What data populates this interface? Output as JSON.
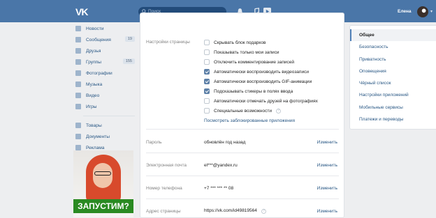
{
  "header": {
    "logo": "VK",
    "search_placeholder": "Поиск",
    "user_name": "Елена"
  },
  "nav": {
    "items": [
      {
        "label": "Новости",
        "icon": "news-icon"
      },
      {
        "label": "Сообщения",
        "icon": "messages-icon",
        "badge": "19"
      },
      {
        "label": "Друзья",
        "icon": "friends-icon"
      },
      {
        "label": "Группы",
        "icon": "groups-icon",
        "badge": "155"
      },
      {
        "label": "Фотографии",
        "icon": "photos-icon"
      },
      {
        "label": "Музыка",
        "icon": "music-icon"
      },
      {
        "label": "Видео",
        "icon": "video-icon"
      },
      {
        "label": "Игры",
        "icon": "games-icon"
      }
    ],
    "items2": [
      {
        "label": "Товары",
        "icon": "goods-icon"
      },
      {
        "label": "Документы",
        "icon": "documents-icon"
      },
      {
        "label": "Реклама",
        "icon": "ads-icon"
      }
    ]
  },
  "ad": {
    "cta": "ЗАПУСТИМ?"
  },
  "settings": {
    "page_settings_label": "Настройки страницы",
    "checkboxes": [
      {
        "label": "Скрывать блок подарков",
        "checked": false
      },
      {
        "label": "Показывать только мои записи",
        "checked": false
      },
      {
        "label": "Отключить комментирование записей",
        "checked": false
      },
      {
        "label": "Автоматически воспроизводить видеозаписи",
        "checked": true
      },
      {
        "label": "Автоматически воспроизводить GIF-анимации",
        "checked": true
      },
      {
        "label": "Подсказывать стикеры в полях ввода",
        "checked": true
      },
      {
        "label": "Автоматически отмечать друзей на фотографиях",
        "checked": false
      },
      {
        "label": "Специальные возможности",
        "checked": false,
        "help": "?"
      }
    ],
    "blocked_apps_link": "Посмотреть заблокированные приложения",
    "rows": [
      {
        "label": "Пароль",
        "value": "обновлён год назад",
        "action": "Изменить"
      },
      {
        "label": "Электронная почта",
        "value": "el***@yandex.ru",
        "action": "Изменить"
      },
      {
        "label": "Номер телефона",
        "value": "+7 *** *** ** 08",
        "action": "Изменить"
      },
      {
        "label": "Адрес страницы",
        "value": "https://vk.com/id49819564",
        "action": "Изменить",
        "help": "?"
      }
    ]
  },
  "rightmenu": {
    "items": [
      {
        "label": "Общее",
        "active": true
      },
      {
        "label": "Безопасность"
      },
      {
        "label": "Приватность"
      },
      {
        "label": "Оповещения"
      },
      {
        "label": "Чёрный список"
      },
      {
        "label": "Настройки приложений"
      },
      {
        "label": "Мобильные сервисы"
      },
      {
        "label": "Платежи и переводы"
      }
    ]
  }
}
